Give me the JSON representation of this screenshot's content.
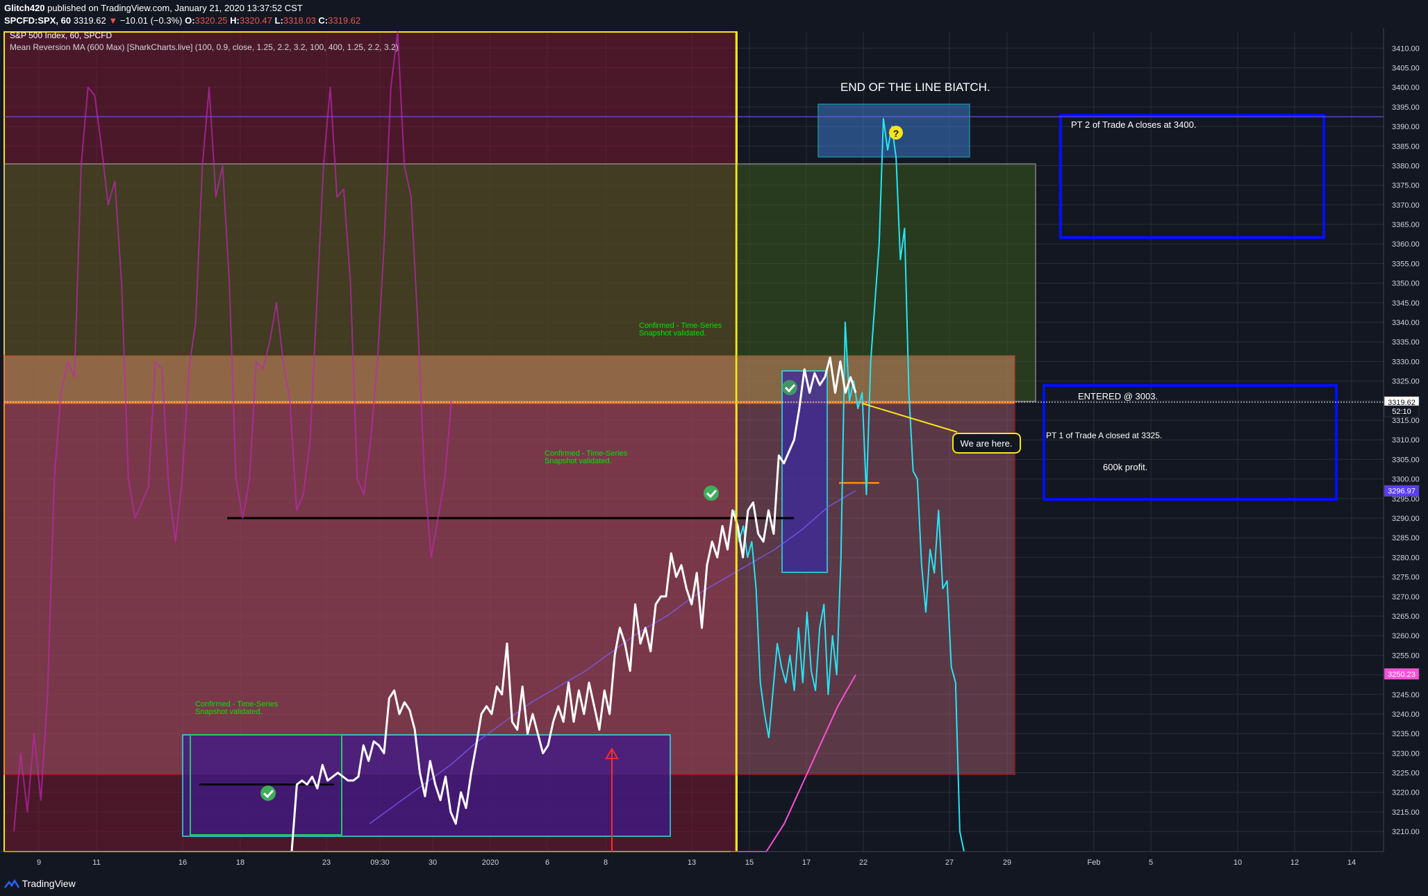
{
  "header": {
    "author": "Glitch420",
    "published": "published on TradingView.com, January 21, 2020 13:37:52 CST",
    "symbol": "SPCFD:SPX, 60",
    "last": "3319.62",
    "change": "−10.01 (−0.3%)",
    "open_label": "O:",
    "open": "3320.25",
    "high_label": "H:",
    "high": "3320.47",
    "low_label": "L:",
    "low": "3318.03",
    "close_label": "C:",
    "close": "3319.62"
  },
  "legend": {
    "line1": "S&P 500 Index, 60, SPCFD",
    "line2": "Mean Reversion MA (600 Max) [SharkCharts.live] (100, 0.9, close, 1.25, 2.2, 3.2, 100, 400, 1.25, 2.2, 3.2)"
  },
  "annotations": {
    "title": "END OF THE LINE BIATCH.",
    "pt2": "PT 2 of Trade A closes at 3400.",
    "entered": "ENTERED @ 3003.",
    "pt1": "PT 1 of Trade A closed at 3325.",
    "profit": "600k profit.",
    "we_are_here": "We are here.",
    "confirmed_line1": "Confirmed - Time-Series",
    "confirmed_line2": "Snapshot validated.",
    "question": "?"
  },
  "footer": {
    "brand": "TradingView"
  },
  "colors": {
    "background": "#131722",
    "price": "#ffffff",
    "projection": "#26e5f5",
    "oscillator": "#c026b4",
    "ma_purple": "#7b5cff",
    "ma_pink": "#ff4fd8",
    "yellow": "#f5e51b",
    "confirm_green": "#00e600",
    "blue_box": "#0010ff"
  },
  "chart_data": {
    "type": "line",
    "y_axis_ticks": [
      3410,
      3405,
      3400,
      3395,
      3390,
      3385,
      3380,
      3375,
      3370,
      3365,
      3360,
      3355,
      3350,
      3345,
      3340,
      3335,
      3330,
      3325,
      3320,
      3315,
      3310,
      3305,
      3300,
      3295,
      3290,
      3285,
      3280,
      3275,
      3270,
      3265,
      3260,
      3255,
      3250,
      3245,
      3240,
      3235,
      3230,
      3225,
      3220,
      3215,
      3210
    ],
    "ylim": [
      3208,
      3412
    ],
    "price_tags": [
      {
        "label": "3319.62",
        "value": 3319.62,
        "color": "#ffffff",
        "text": "#131722"
      },
      {
        "label": "52:10",
        "value": 3317.3,
        "color": "#131722",
        "text": "#ffffff"
      },
      {
        "label": "3296.97",
        "value": 3296.97,
        "color": "#5b3cff",
        "text": "#ffffff"
      },
      {
        "label": "3250.23",
        "value": 3250.23,
        "color": "#ff4fd8",
        "text": "#ffffff"
      }
    ],
    "x_ticks": [
      "9",
      "11",
      "16",
      "18",
      "23",
      "09:30",
      "30",
      "2020",
      "6",
      "8",
      "13",
      "15",
      "17",
      "22",
      "27",
      "29",
      "Feb",
      "5",
      "10",
      "12",
      "14"
    ],
    "series": [
      {
        "values": [
          3200,
          3222,
          3223,
          3222,
          3224,
          3221,
          3227,
          3223,
          3224,
          3225,
          3224,
          3223,
          3223,
          3224,
          3232,
          3228,
          3233,
          3232,
          3230,
          3244,
          3246,
          3240,
          3243,
          3241,
          3236,
          3225,
          3219,
          3228,
          3222,
          3218,
          3224,
          3215,
          3212,
          3220,
          3216,
          3225,
          3232,
          3240,
          3242,
          3240,
          3247,
          3245,
          3258,
          3238,
          3236,
          3247,
          3235,
          3240,
          3235,
          3230,
          3232,
          3238,
          3242,
          3238,
          3248,
          3238,
          3246,
          3240,
          3248,
          3242,
          3236,
          3246,
          3240,
          3255,
          3262,
          3258,
          3251,
          3268,
          3258,
          3262,
          3256,
          3268,
          3270,
          3270,
          3281,
          3275,
          3278,
          3272,
          3268,
          3276,
          3262,
          3278,
          3284,
          3280,
          3288,
          3282,
          3292,
          3288,
          3280,
          3292,
          3294,
          3286,
          3284,
          3292,
          3286,
          3306,
          3304,
          3307,
          3310,
          3318,
          3328,
          3322,
          3327,
          3324,
          3326,
          3331,
          3322,
          3330,
          3322,
          3326,
          3322
        ]
      },
      {
        "values": [
          3292,
          3284,
          3288,
          3280,
          3284,
          3272,
          3248,
          3240,
          3234,
          3246,
          3258,
          3252,
          3248,
          3255,
          3246,
          3262,
          3248,
          3266,
          3251,
          3246,
          3262,
          3268,
          3245,
          3260,
          3250,
          3280,
          3340,
          3320,
          3325,
          3318,
          3322,
          3296,
          3330,
          3345,
          3360,
          3392,
          3384,
          3390,
          3382,
          3356,
          3364,
          3322,
          3302,
          3300,
          3278,
          3266,
          3282,
          3276,
          3292,
          3272,
          3274,
          3252,
          3248,
          3210,
          3190
        ]
      },
      {
        "values": [
          3210,
          3230,
          3215,
          3235,
          3218,
          3245,
          3300,
          3322,
          3330,
          3326,
          3380,
          3400,
          3398,
          3385,
          3370,
          3376,
          3350,
          3300,
          3290,
          3294,
          3298,
          3330,
          3328,
          3298,
          3284,
          3300,
          3328,
          3340,
          3380,
          3400,
          3372,
          3380,
          3350,
          3300,
          3290,
          3300,
          3330,
          3328,
          3335,
          3345,
          3330,
          3320,
          3292,
          3296,
          3310,
          3345,
          3380,
          3400,
          3372,
          3374,
          3350,
          3300,
          3296,
          3310,
          3330,
          3360,
          3400,
          3420,
          3380,
          3372,
          3340,
          3300,
          3280,
          3290,
          3300,
          3320
        ]
      },
      {
        "values": [
          3212,
          3217,
          3222,
          3227,
          3233,
          3238,
          3243,
          3247,
          3251,
          3256,
          3261,
          3265,
          3270,
          3274,
          3278,
          3282,
          3287,
          3293,
          3297
        ]
      },
      {
        "values": [
          3178,
          3188,
          3200,
          3212,
          3222,
          3232,
          3242,
          3250
        ]
      }
    ],
    "levels": [
      {
        "value": 3290,
        "color": "#000000"
      },
      {
        "value": 3222,
        "color": "#000000"
      },
      {
        "value": 3299,
        "color": "#ff8c00"
      },
      {
        "value": 3392.5,
        "color": "#7b5cff"
      }
    ]
  }
}
